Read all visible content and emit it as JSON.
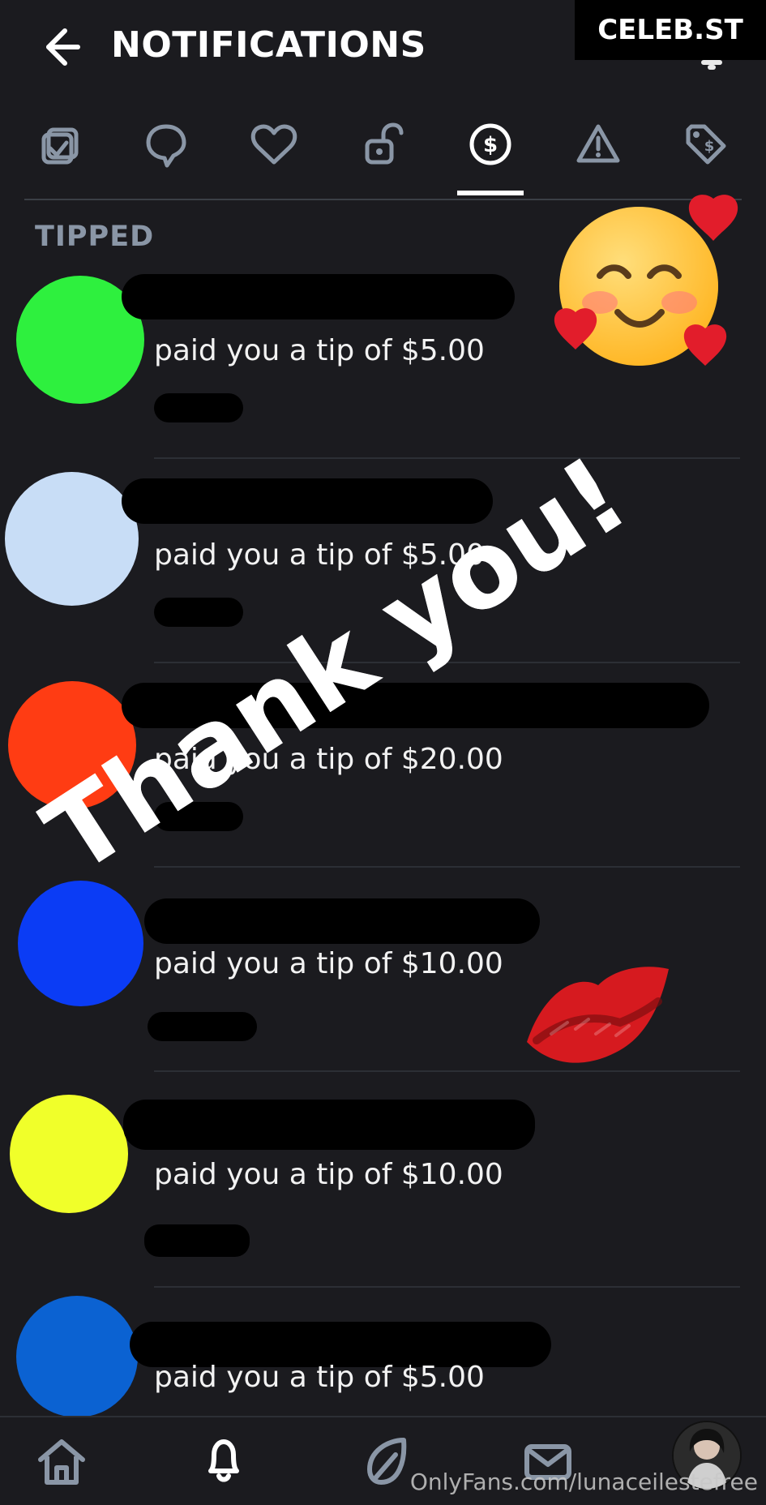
{
  "header": {
    "title": "NOTIFICATIONS",
    "brand": "CELEB.ST"
  },
  "tabs": [
    {
      "icon": "checklist-icon"
    },
    {
      "icon": "comment-icon"
    },
    {
      "icon": "heart-icon"
    },
    {
      "icon": "unlock-icon"
    },
    {
      "icon": "dollar-icon",
      "active": true
    },
    {
      "icon": "warning-icon"
    },
    {
      "icon": "tag-icon"
    }
  ],
  "section": {
    "title": "TIPPED"
  },
  "items": [
    {
      "color": "#2ef03e",
      "text": "paid you a tip of $5.00"
    },
    {
      "color": "#c8ddf6",
      "text": "paid you a tip of $5.00"
    },
    {
      "color": "#ff3c13",
      "text": "paid you a tip of $20.00"
    },
    {
      "color": "#0b3cf5",
      "text": "paid you a tip of $10.00"
    },
    {
      "color": "#f0ff2a",
      "text": "paid you a tip of $10.00"
    },
    {
      "color": "#0b62d2",
      "text": "paid you a tip of $5.00"
    }
  ],
  "overlay": {
    "text": "Thank you!"
  },
  "bottom_nav": [
    {
      "icon": "home-icon"
    },
    {
      "icon": "bell-icon"
    },
    {
      "icon": "leaf-icon"
    },
    {
      "icon": "mail-icon"
    }
  ],
  "watermark": {
    "text": "OnlyFans.com/lunaceilestefree"
  }
}
